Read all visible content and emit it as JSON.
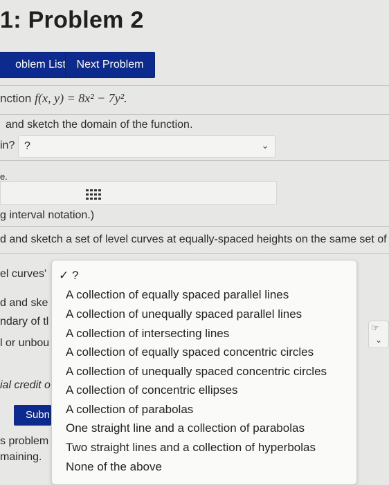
{
  "header": {
    "title": "1: Problem 2"
  },
  "nav": {
    "problem_list": "oblem List",
    "next_problem": "Next Problem"
  },
  "question": {
    "function_prefix": "nction",
    "function_expr": "f(x, y) = 8x² − 7y².",
    "sketch_text": "and sketch the domain of the function.",
    "domain_prefix": "in?",
    "domain_value": "?",
    "line_e": "e.",
    "interval_text": "g interval notation.)",
    "level_curves_text": "d and sketch a set of level curves at equally-spaced heights on the same set of a:",
    "curves_label": "el curves'",
    "frag_and": "d and ske",
    "frag_boundary": "ndary of tl",
    "frag_unbounded": "l or unbou",
    "frag_partial": "ial credit o",
    "submit_label": "Subn",
    "frag_problem": "s problem",
    "frag_remaining": "maining."
  },
  "dropdown": {
    "selected_label": "✓ ?",
    "options": [
      "A collection of equally spaced parallel lines",
      "A collection of unequally spaced parallel lines",
      "A collection of intersecting lines",
      "A collection of equally spaced concentric circles",
      "A collection of unequally spaced concentric circles",
      "A collection of concentric ellipses",
      "A collection of parabolas",
      "One straight line and a collection of parabolas",
      "Two straight lines and a collection of hyperbolas",
      "None of the above"
    ]
  },
  "icons": {
    "chevron": "chevron-down-icon",
    "grid": "equation-editor-icon",
    "hand": "pointer-hand-icon"
  }
}
